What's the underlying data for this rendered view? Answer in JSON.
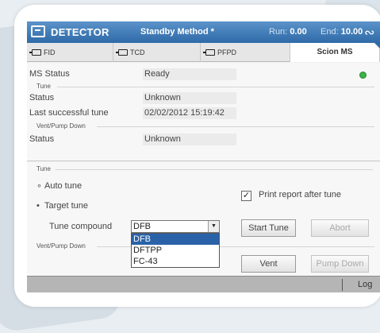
{
  "titlebar": {
    "title": "DETECTOR",
    "method": "Standby Method *",
    "run_label": "Run:",
    "run_value": "0.00",
    "end_label": "End:",
    "end_value": "10.00",
    "icon": "monitor-icon",
    "right_icon": "wave-icon"
  },
  "tabs": [
    {
      "label": "FID",
      "icon": "plug-icon"
    },
    {
      "label": "TCD",
      "icon": "plug-icon"
    },
    {
      "label": "PFPD",
      "icon": "plug-icon"
    },
    {
      "label": "Scion MS",
      "active": true
    }
  ],
  "ms_status": {
    "label": "MS Status",
    "value": "Ready",
    "indicator_color": "#3fb24a"
  },
  "tune_section": {
    "header": "Tune",
    "status_label": "Status",
    "status_value": "Unknown",
    "last_tune_label": "Last successful tune",
    "last_tune_value": "02/02/2012 15:19:42"
  },
  "vent_section": {
    "header": "Vent/Pump Down",
    "status_label": "Status",
    "status_value": "Unknown"
  },
  "tune_panel": {
    "header": "Tune",
    "auto_tune": "Auto tune",
    "target_tune": "Target tune",
    "selected_mode": "Target tune",
    "print_report": "Print report after tune",
    "print_report_checked": true,
    "compound_label": "Tune compound",
    "compound_value": "DFB",
    "compound_options": [
      "DFB",
      "DFTPP",
      "FC-43"
    ],
    "start_tune": "Start Tune",
    "abort": "Abort"
  },
  "vent_panel": {
    "header": "Vent/Pump Down",
    "vent": "Vent",
    "pump_down": "Pump Down"
  },
  "statusbar": {
    "log": "Log"
  },
  "colors": {
    "titlebar": "#2f6aa8",
    "selection": "#2a62a8",
    "ready": "#3fb24a"
  }
}
